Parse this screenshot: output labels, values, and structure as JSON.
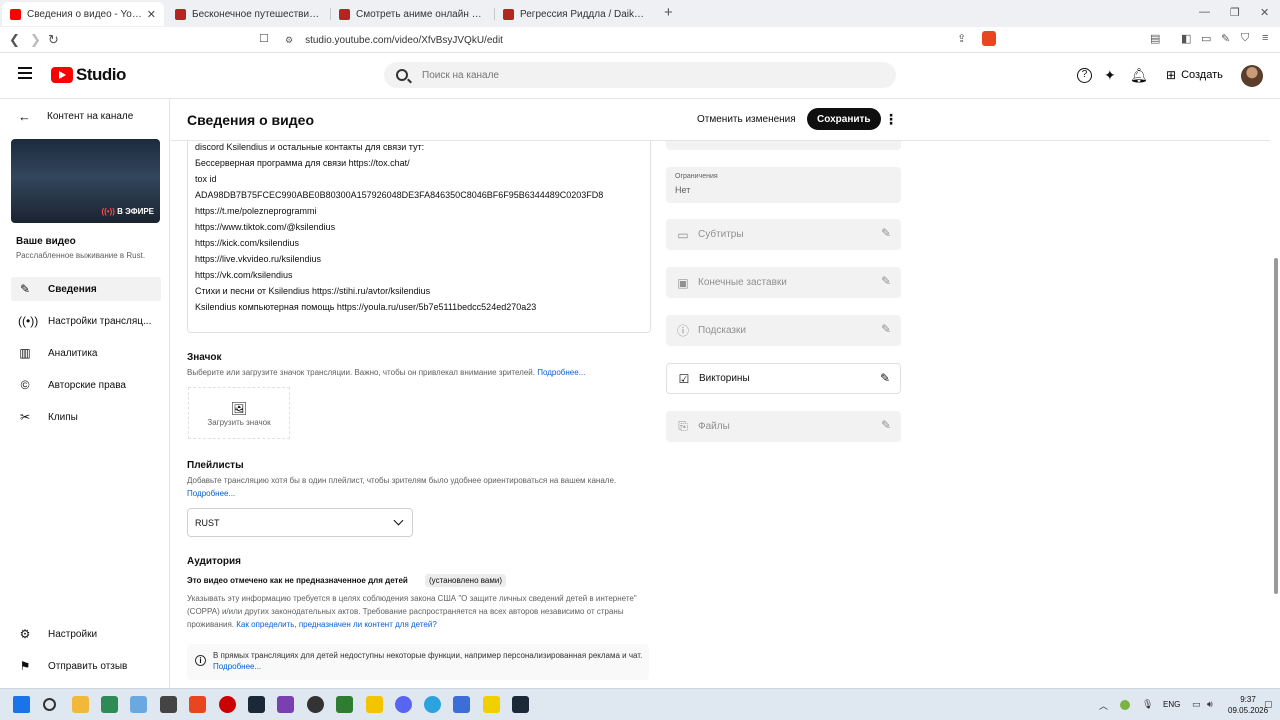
{
  "browser": {
    "tabs": [
      {
        "title": "Сведения о видео - YouTube Studio",
        "favicon_color": "#ff0000"
      },
      {
        "title": "Бесконечное путешествие корабля",
        "favicon_color": "#b3261e"
      },
      {
        "title": "Смотреть аниме онлайн и многое",
        "favicon_color": "#b3261e"
      },
      {
        "title": "Регрессия Риддла / Daikenja Riddle",
        "favicon_color": "#b3261e"
      }
    ],
    "new_tab": "+",
    "url": "studio.youtube.com/video/XfvBsyJVQkU/edit"
  },
  "header": {
    "logo_text": "Studio",
    "search_placeholder": "Поиск на канале",
    "create_label": "Создать"
  },
  "sidebar": {
    "back_label": "Контент на канале",
    "live_badge": "В ЭФИРЕ",
    "your_video": "Ваше видео",
    "video_title": "Расслабленное выживание в Rust.",
    "items": [
      {
        "label": "Сведения",
        "icon": "pencil-icon"
      },
      {
        "label": "Настройки трансляц...",
        "icon": "broadcast-icon"
      },
      {
        "label": "Аналитика",
        "icon": "analytics-icon"
      },
      {
        "label": "Авторские права",
        "icon": "copyright-icon"
      },
      {
        "label": "Клипы",
        "icon": "scissors-icon"
      }
    ],
    "bottom_items": [
      {
        "label": "Настройки",
        "icon": "gear-icon"
      },
      {
        "label": "Отправить отзыв",
        "icon": "feedback-icon"
      }
    ]
  },
  "main": {
    "title": "Сведения о видео",
    "discard_label": "Отменить изменения",
    "save_label": "Сохранить",
    "description_lines": [
      "discord Ksilendius и остальные контакты для связи тут:",
      "Бессерверная программа для связи https://tox.chat/",
      "tox id",
      "ADA98DB7B75FCEC990ABE0B80300A157926048DE3FA846350C8046BF6F95B6344489C0203FD8",
      "https://t.me/polezneprogrammi",
      "https://www.tiktok.com/@ksilendius",
      "https://kick.com/ksilendius",
      "https://live.vkvideo.ru/ksilendius",
      "https://vk.com/ksilendius",
      "Стихи и песни от Ksilendius https://stihi.ru/avtor/ksilendius",
      "Ksilendius компьютерная помощь  https://youla.ru/user/5b7e5111bedcc524ed270a23"
    ],
    "thumbnail": {
      "title": "Значок",
      "desc": "Выберите или загрузите значок трансляции. Важно, чтобы он привлекал внимание зрителей.",
      "link": "Подробнее...",
      "upload_label": "Загрузить значок"
    },
    "playlists": {
      "title": "Плейлисты",
      "desc": "Добавьте трансляцию хотя бы в один плейлист, чтобы зрителям было удобнее ориентироваться на вашем канале.",
      "link": "Подробнее...",
      "selected": "RUST"
    },
    "audience": {
      "title": "Аудитория",
      "status": "Это видео отмечено как не предназначенное для детей",
      "badge": "(установлено вами)",
      "desc": "Указывать эту информацию требуется в целях соблюдения закона США \"О защите личных сведений детей в интернете\" (COPPA) и/или других законодательных актов. Требование распространяется на всех авторов независимо от страны проживания.",
      "link": "Как определить, предназначен ли контент для детей?",
      "notice": "В прямых трансляциях для детей недоступны некоторые функции, например персонализированная реклама и чат.",
      "notice_link": "Подробнее..."
    }
  },
  "right": {
    "restrictions_label": "Ограничения",
    "restrictions_value": "Нет",
    "options": [
      {
        "label": "Субтитры",
        "icon": "subtitles-icon",
        "enabled": false
      },
      {
        "label": "Конечные заставки",
        "icon": "end-screen-icon",
        "enabled": false
      },
      {
        "label": "Подсказки",
        "icon": "info-icon",
        "enabled": false
      },
      {
        "label": "Викторины",
        "icon": "checkbox-icon",
        "enabled": true
      },
      {
        "label": "Файлы",
        "icon": "files-icon",
        "enabled": false
      }
    ]
  },
  "taskbar": {
    "lang": "ENG",
    "time": "9:37",
    "date": "09.05.2026"
  }
}
